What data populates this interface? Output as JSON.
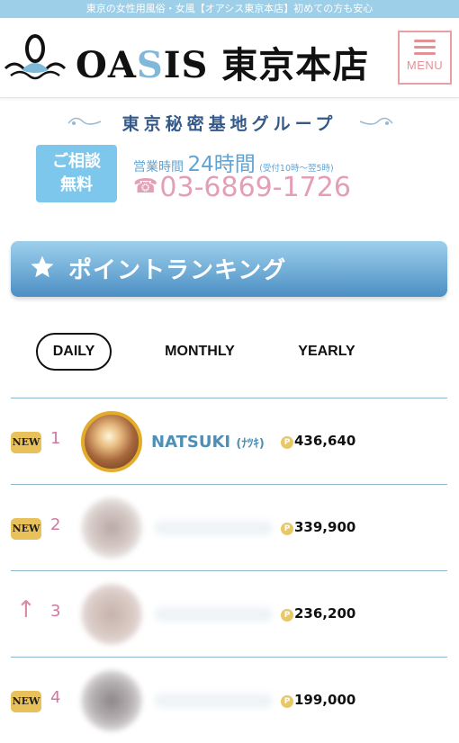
{
  "topbar": {
    "text": "東京の女性用風俗・女風【オアシス東京本店】初めての方も安心"
  },
  "header": {
    "logo_part1": "OA",
    "logo_s": "S",
    "logo_part2": "IS 東京本店",
    "menu_label": "MENU"
  },
  "group": {
    "name": "東京秘密基地グループ"
  },
  "contact": {
    "consult_line1": "ご相談",
    "consult_line2": "無料",
    "hours_label": "営業時間",
    "hours_value": "24時間",
    "hours_note": "(受付10時〜翌5時)",
    "phone": "03-6869-1726",
    "phone_icon": "☎"
  },
  "ranking": {
    "title": "ポイントランキング",
    "tabs": {
      "daily": "DAILY",
      "monthly": "MONTHLY",
      "yearly": "YEARLY"
    },
    "rows": [
      {
        "badge": "NEW",
        "rank": "1",
        "name": "NATSUKI",
        "kana": "(ﾅﾂｷ)",
        "points": "436,640",
        "coin": "P"
      },
      {
        "badge": "NEW",
        "rank": "2",
        "points": "339,900",
        "coin": "P"
      },
      {
        "arrow": "↑",
        "rank": "3",
        "points": "236,200",
        "coin": "P"
      },
      {
        "badge": "NEW",
        "rank": "4",
        "points": "199,000",
        "coin": "P"
      }
    ]
  },
  "colors": {
    "accent_blue": "#5fa4d5",
    "pink": "#e49fb4",
    "gold": "#e9c15a"
  }
}
